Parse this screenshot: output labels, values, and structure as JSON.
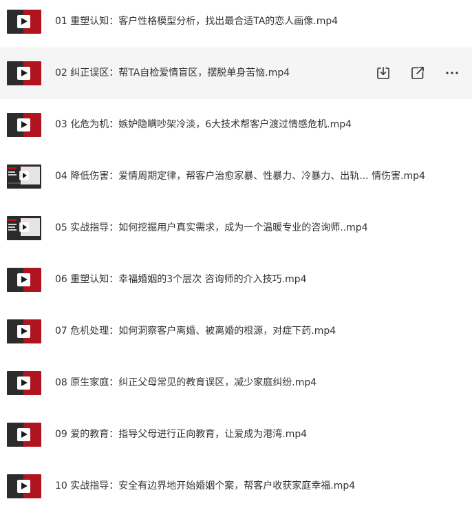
{
  "files": [
    {
      "name": "01 重塑认知：客户性格模型分析，找出最合适TA的恋人画像.mp4",
      "thumb": "video"
    },
    {
      "name": "02 纠正误区：帮TA自检爱情盲区，摆脱单身苦恼.mp4",
      "thumb": "video"
    },
    {
      "name": "03 化危为机：嫉妒隐瞒吵架冷淡，6大技术帮客户渡过情感危机.mp4",
      "thumb": "video"
    },
    {
      "name": "04 降低伤害：爱情周期定律，帮客户治愈家暴、性暴力、冷暴力、出轨... 情伤害.mp4",
      "thumb": "photo"
    },
    {
      "name": "05 实战指导：如何挖掘用户真实需求，成为一个温暖专业的咨询师..mp4",
      "thumb": "photo"
    },
    {
      "name": "06 重塑认知：幸福婚姻的3个层次 咨询师的介入技巧.mp4",
      "thumb": "video"
    },
    {
      "name": "07 危机处理：如何洞察客户离婚、被离婚的根源，对症下药.mp4",
      "thumb": "video"
    },
    {
      "name": "08 原生家庭：纠正父母常见的教育误区，减少家庭纠纷.mp4",
      "thumb": "video"
    },
    {
      "name": "09 爱的教育：指导父母进行正向教育，让爱成为港湾.mp4",
      "thumb": "video"
    },
    {
      "name": "10 实战指导：安全有边界地开始婚姻个案，帮客户收获家庭幸福.mp4",
      "thumb": "video"
    }
  ],
  "hovered_row_actions": [
    "download-icon",
    "share-icon",
    "more-icon"
  ],
  "colors": {
    "hover_background": "#f5f5f5",
    "thumb_red": "#b0141f",
    "thumb_dark": "#2c2c2c",
    "text": "#333333"
  }
}
